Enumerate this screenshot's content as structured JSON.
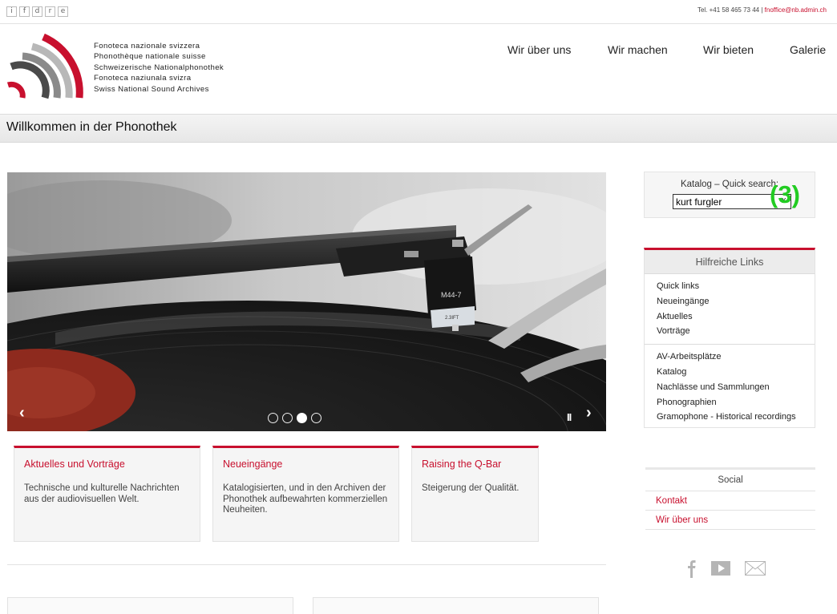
{
  "topbar": {
    "languages": [
      "i",
      "f",
      "d",
      "r",
      "e"
    ],
    "contact_prefix": "Tel. +41 58 465 73 44 | ",
    "contact_email": "fnoffice@nb.admin.ch"
  },
  "header": {
    "institution_lines": [
      "Fonoteca nazionale svizzera",
      "Phonothèque nationale suisse",
      "Schweizerische Nationalphonothek",
      "Fonoteca naziunala svizra",
      "Swiss National Sound Archives"
    ],
    "nav": [
      "Wir über uns",
      "Wir machen",
      "Wir bieten",
      "Galerie"
    ]
  },
  "page": {
    "title": "Willkommen in der Phonothek"
  },
  "carousel": {
    "cartridge_model": "M44-7",
    "stylus_label": "2.3IFT",
    "prev_label": "‹",
    "next_label": "›",
    "pause_label": "II",
    "slide_count": 4,
    "active_slide": 3
  },
  "features": [
    {
      "title": "Aktuelles und Vorträge",
      "text": "Technische und kulturelle Nachrichten aus der audiovisuellen Welt."
    },
    {
      "title": "Neueingänge",
      "text": "Katalogisierten, und in den Archiven der Phonothek aufbewahrten kommerziellen Neuheiten."
    },
    {
      "title": "Raising the Q-Bar",
      "text": "Steigerung der Qualität."
    }
  ],
  "search": {
    "label": "Katalog – Quick search:",
    "value": "kurt furgler",
    "clear_label": "x",
    "annotation": "(3)"
  },
  "helpful_links": {
    "title": "Hilfreiche Links",
    "group1": [
      "Quick links",
      "Neueingänge",
      "Aktuelles",
      "Vorträge"
    ],
    "group2": [
      "AV-Arbeitsplätze",
      "Katalog",
      "Nachlässe und Sammlungen",
      "Phonographien",
      "Gramophone - Historical recordings"
    ]
  },
  "social": {
    "title": "Social",
    "items": [
      "Kontakt",
      "Wir über uns"
    ],
    "icons": [
      "facebook-icon",
      "youtube-icon",
      "email-icon"
    ]
  },
  "colors": {
    "accent": "#c8102e",
    "annotation": "#22cc22"
  }
}
